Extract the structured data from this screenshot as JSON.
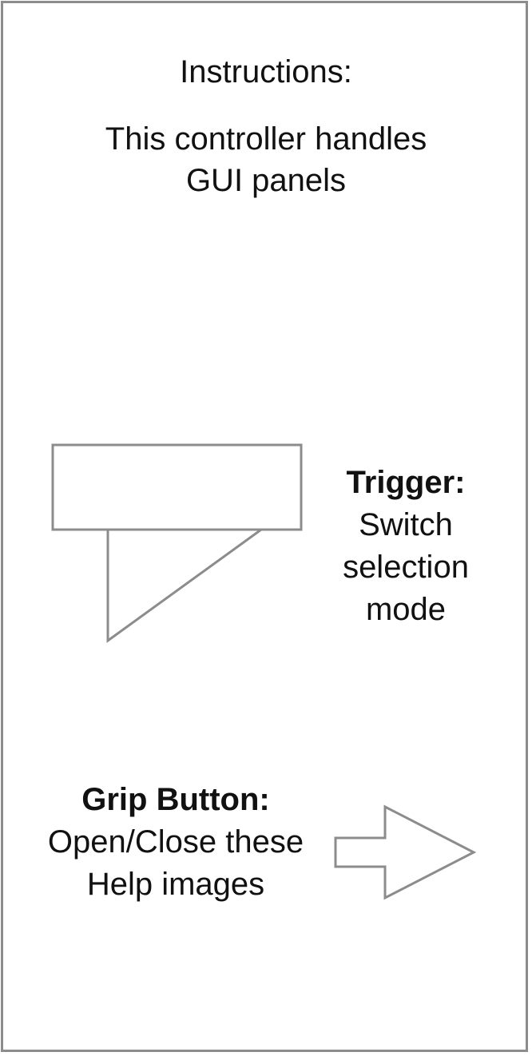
{
  "header": {
    "title": "Instructions:",
    "description_lines": [
      "This controller handles",
      "GUI panels"
    ]
  },
  "trigger": {
    "title": "Trigger:",
    "lines": [
      "Switch",
      "selection",
      "mode"
    ]
  },
  "grip": {
    "title": "Grip Button:",
    "lines": [
      "Open/Close these",
      "Help images"
    ]
  },
  "colors": {
    "stroke": "#8c8c8c",
    "text": "#111111",
    "background": "#ffffff"
  },
  "icons": {
    "trigger": "trigger-shape-icon",
    "grip": "arrow-right-icon"
  }
}
